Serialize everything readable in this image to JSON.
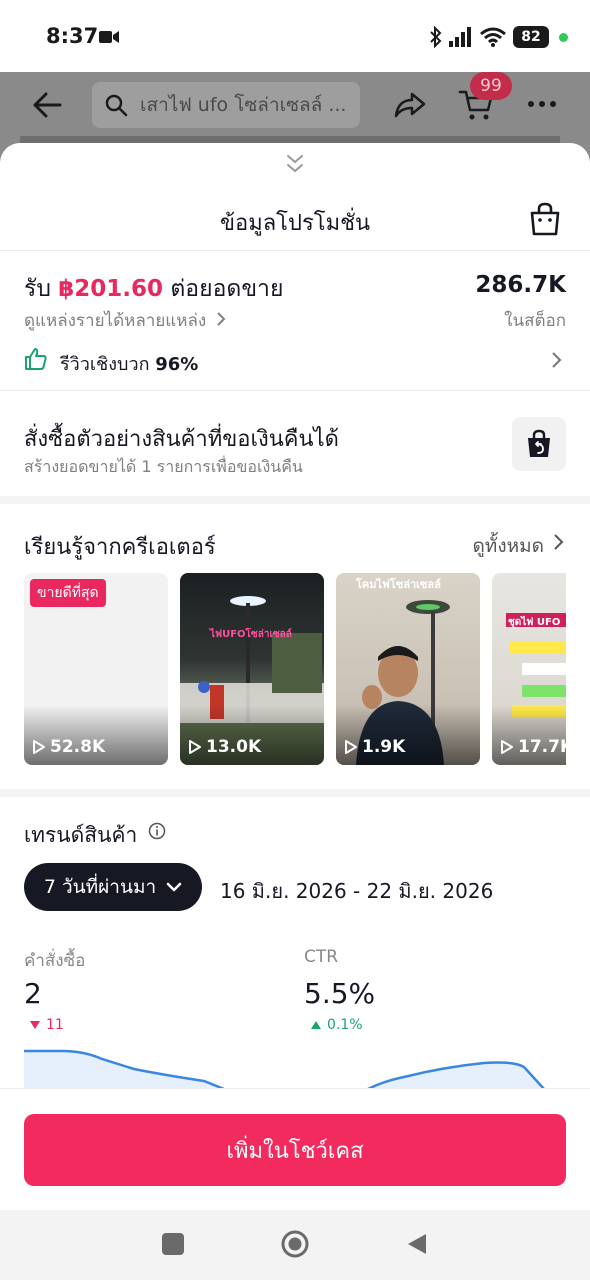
{
  "status_bar": {
    "time": "8:37",
    "battery": "82"
  },
  "header": {
    "search_text": "เสาไฟ ufo โซล่าเซลล์ ...",
    "cart_badge": "99",
    "icons": [
      "back-arrow-icon",
      "search-icon",
      "share-icon",
      "cart-icon",
      "more-icon"
    ]
  },
  "sheet": {
    "title": "ข้อมูลโปรโมชั่น",
    "earn": {
      "prefix": "รับ",
      "amount": "฿201.60",
      "suffix": "ต่อยอดขาย"
    },
    "income_link": "ดูแหล่งรายได้หลายแหล่ง",
    "stock": {
      "value": "286.7K",
      "label": "ในสต็อก"
    },
    "review": {
      "label": "รีวิวเชิงบวก",
      "value": "96%"
    },
    "sample": {
      "title": "สั่งซื้อตัวอย่างสินค้าที่ขอเงินคืนได้",
      "subtitle": "สร้างยอดขายได้ 1 รายการเพื่อขอเงินคืน"
    },
    "creators": {
      "title": "เรียนรู้จากครีเอเตอร์",
      "see_all": "ดูทั้งหมด",
      "best_badge": "ขายดีที่สุด",
      "videos": [
        {
          "views": "52.8K"
        },
        {
          "views": "13.0K",
          "overlay": "ไฟUFOโซล่าเซลล์"
        },
        {
          "views": "1.9K",
          "overlay": "โคมไฟโซล่าเซลล์"
        },
        {
          "views": "17.7K",
          "overlay": "ชุดไฟ UFO"
        }
      ]
    },
    "trend": {
      "title": "เทรนด์สินค้า",
      "period": "7 วันที่ผ่านมา",
      "date_range": "16 มิ.ย. 2026 - 22 มิ.ย. 2026",
      "metrics": [
        {
          "label": "คำสั่งซื้อ",
          "value": "2",
          "delta": "11",
          "direction": "down"
        },
        {
          "label": "CTR",
          "value": "5.5%",
          "delta": "0.1%",
          "direction": "up"
        }
      ]
    }
  },
  "cta": {
    "label": "เพิ่มในโชว์เคส"
  },
  "colors": {
    "accent": "#f22a5e",
    "price": "#e8285e",
    "positive": "#19a56b",
    "chart_line": "#3a86e0"
  }
}
